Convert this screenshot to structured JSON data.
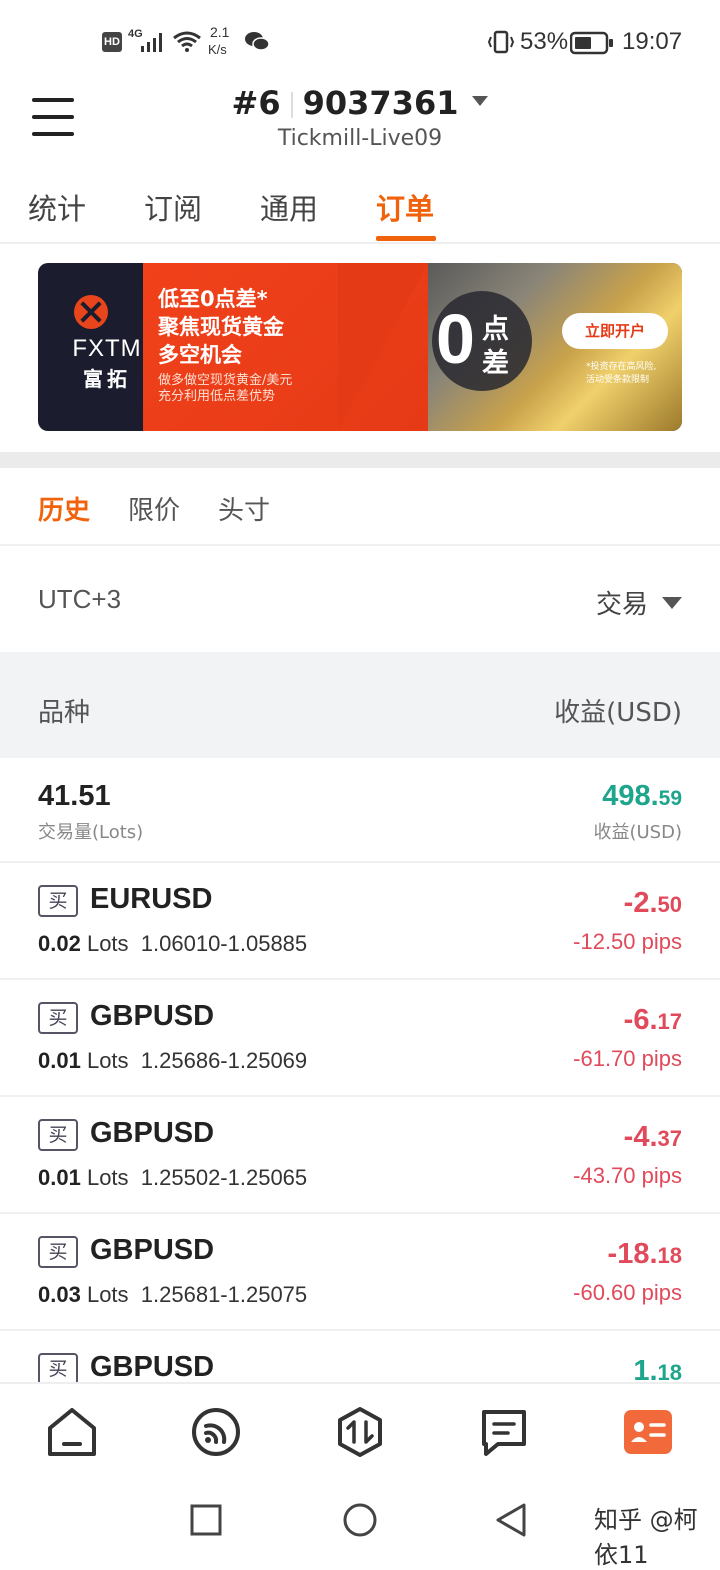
{
  "status_bar": {
    "hd": "HD",
    "network": "4G",
    "speed_value": "2.1",
    "speed_unit": "K/s",
    "battery_percent": "53%",
    "time": "19:07"
  },
  "header": {
    "account_index": "#6",
    "account_number": "9037361",
    "server": "Tickmill-Live09"
  },
  "top_tabs": [
    {
      "label": "统计"
    },
    {
      "label": "订阅"
    },
    {
      "label": "通用"
    },
    {
      "label": "订单",
      "active": true
    }
  ],
  "banner": {
    "brand": "FXTM",
    "brand_cn": "富拓",
    "line1": "低至0点差*",
    "line2": "聚焦现货黄金",
    "line3": "多空机会",
    "line4": "做多做空现货黄金/美元",
    "line5": "充分利用低点差优势",
    "big_zero": "0",
    "big_dian": "点",
    "big_cha": "差",
    "cta": "立即开户",
    "disclaimer1": "*投资存在高风险,",
    "disclaimer2": "活动受条款限制"
  },
  "sub_tabs": [
    {
      "label": "历史",
      "active": true
    },
    {
      "label": "限价"
    },
    {
      "label": "头寸"
    }
  ],
  "filters": {
    "timezone": "UTC+3",
    "type": "交易"
  },
  "list_header": {
    "left": "品种",
    "right": "收益(USD)"
  },
  "summary": {
    "volume": "41.51",
    "volume_label": "交易量(Lots)",
    "profit_int": "498.",
    "profit_dec": "59",
    "profit_label": "收益(USD)"
  },
  "orders": [
    {
      "side": "买",
      "symbol": "EURUSD",
      "lots": "0.02",
      "lots_unit": "Lots",
      "prices": "1.06010-1.05885",
      "profit_int": "-2.",
      "profit_dec": "50",
      "pips": "-12.50 pips",
      "sign": "neg"
    },
    {
      "side": "买",
      "symbol": "GBPUSD",
      "lots": "0.01",
      "lots_unit": "Lots",
      "prices": "1.25686-1.25069",
      "profit_int": "-6.",
      "profit_dec": "17",
      "pips": "-61.70 pips",
      "sign": "neg"
    },
    {
      "side": "买",
      "symbol": "GBPUSD",
      "lots": "0.01",
      "lots_unit": "Lots",
      "prices": "1.25502-1.25065",
      "profit_int": "-4.",
      "profit_dec": "37",
      "pips": "-43.70 pips",
      "sign": "neg"
    },
    {
      "side": "买",
      "symbol": "GBPUSD",
      "lots": "0.03",
      "lots_unit": "Lots",
      "prices": "1.25681-1.25075",
      "profit_int": "-18.",
      "profit_dec": "18",
      "pips": "-60.60 pips",
      "sign": "neg"
    },
    {
      "side": "买",
      "symbol": "GBPUSD",
      "lots": "",
      "lots_unit": "",
      "prices": "",
      "profit_int": "1.",
      "profit_dec": "18",
      "pips": "",
      "sign": "pos"
    }
  ],
  "bottom_nav": [
    {
      "icon": "home-icon"
    },
    {
      "icon": "signal-icon"
    },
    {
      "icon": "trade-icon"
    },
    {
      "icon": "news-icon"
    },
    {
      "icon": "account-card-icon",
      "active": true
    }
  ],
  "colors": {
    "accent": "#f0620c",
    "positive": "#1fa58b",
    "negative": "#e04a5a"
  },
  "watermark": "知乎 @柯依11"
}
